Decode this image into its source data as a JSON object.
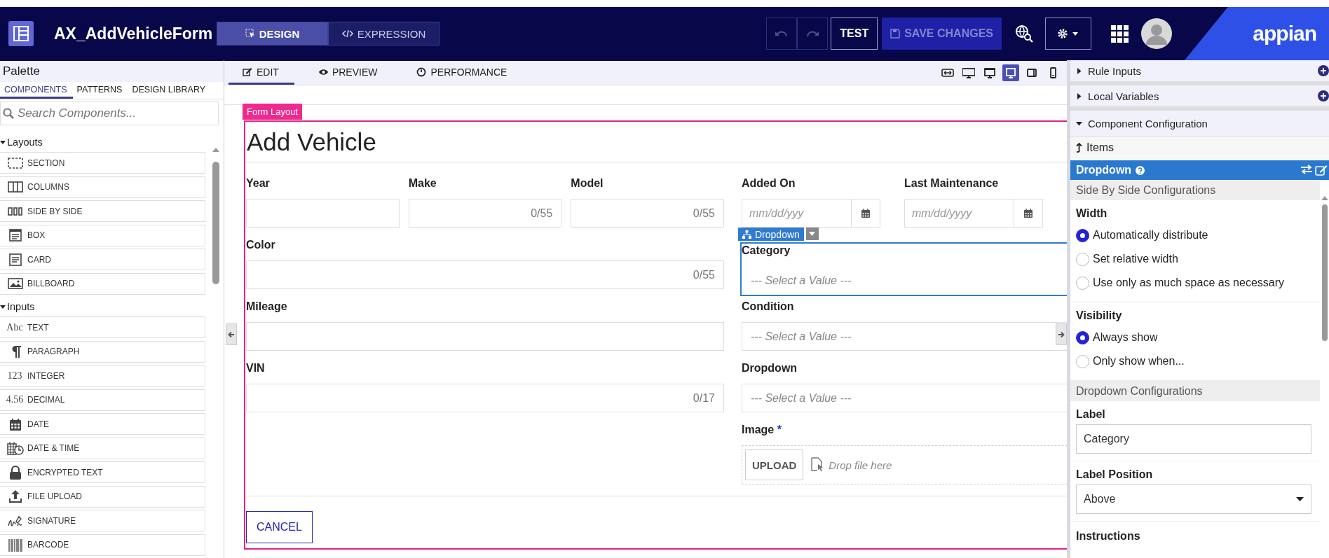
{
  "header": {
    "title": "AX_AddVehicleForm",
    "mode_tabs": [
      {
        "label": "DESIGN",
        "kind": "design",
        "selected": true
      },
      {
        "label": "EXPRESSION",
        "kind": "expression",
        "selected": false
      }
    ],
    "history_buttons": [
      {
        "kind": "undo",
        "disabled": true
      },
      {
        "kind": "redo",
        "disabled": true
      }
    ],
    "test_button": {
      "label": "TEST"
    },
    "save_button": {
      "label": "SAVE CHANGES",
      "disabled": true
    },
    "logo": "appian"
  },
  "palette": {
    "title": "Palette",
    "tabs": [
      {
        "label": "COMPONENTS",
        "selected": true
      },
      {
        "label": "PATTERNS",
        "selected": false
      },
      {
        "label": "DESIGN LIBRARY",
        "selected": false
      }
    ],
    "search": {
      "placeholder": "Search Components..."
    },
    "groups": [
      {
        "label": "Layouts",
        "expanded": true,
        "items": [
          {
            "label": "SECTION",
            "kind": "section"
          },
          {
            "label": "COLUMNS",
            "kind": "columns"
          },
          {
            "label": "SIDE BY SIDE",
            "kind": "sidebyside"
          },
          {
            "label": "BOX",
            "kind": "box"
          },
          {
            "label": "CARD",
            "kind": "card"
          },
          {
            "label": "BILLBOARD",
            "kind": "billboard"
          }
        ]
      },
      {
        "label": "Inputs",
        "expanded": true,
        "items": [
          {
            "label": "TEXT",
            "kind": "glyph",
            "glyph": "Abc"
          },
          {
            "label": "PARAGRAPH",
            "kind": "paragraph"
          },
          {
            "label": "INTEGER",
            "kind": "glyph",
            "glyph": "123"
          },
          {
            "label": "DECIMAL",
            "kind": "glyph",
            "glyph": "4.56"
          },
          {
            "label": "DATE",
            "kind": "date"
          },
          {
            "label": "DATE & TIME",
            "kind": "datetime"
          },
          {
            "label": "ENCRYPTED TEXT",
            "kind": "lock"
          },
          {
            "label": "FILE UPLOAD",
            "kind": "upload"
          },
          {
            "label": "SIGNATURE",
            "kind": "signature"
          },
          {
            "label": "BARCODE",
            "kind": "barcode"
          }
        ]
      }
    ]
  },
  "canvas": {
    "view_tabs": [
      {
        "label": "EDIT",
        "kind": "edit",
        "selected": true
      },
      {
        "label": "PREVIEW",
        "kind": "preview",
        "selected": false
      },
      {
        "label": "PERFORMANCE",
        "kind": "performance",
        "selected": false
      }
    ],
    "device_buttons": [
      {
        "kind": "fit",
        "selected": false
      },
      {
        "kind": "wide",
        "selected": false
      },
      {
        "kind": "desktop",
        "selected": false
      },
      {
        "kind": "monitor",
        "selected": true
      },
      {
        "kind": "tablet",
        "selected": false
      },
      {
        "kind": "phone",
        "selected": false
      }
    ],
    "form": {
      "tag": "Form Layout",
      "title": "Add Vehicle",
      "top_left": [
        {
          "kind": "text",
          "label": "Year",
          "selected": false
        },
        {
          "kind": "text",
          "label": "Make",
          "counter": "0/55",
          "selected": false
        },
        {
          "kind": "text",
          "label": "Model",
          "counter": "0/55",
          "selected": false
        }
      ],
      "top_right": [
        {
          "kind": "date",
          "label": "Added On",
          "placeholder": "mm/dd/yyy",
          "selected": false
        },
        {
          "kind": "date",
          "label": "Last Maintenance",
          "placeholder": "mm/dd/yyyy",
          "selected": false
        }
      ],
      "left_column": [
        {
          "kind": "text",
          "label": "Color",
          "counter": "0/55",
          "selected": false
        },
        {
          "kind": "text",
          "label": "Mileage",
          "selected": false
        },
        {
          "kind": "text",
          "label": "VIN",
          "counter": "0/17",
          "selected": false
        }
      ],
      "right_column": [
        {
          "kind": "dropdown",
          "label": "Category",
          "placeholder": "--- Select a Value ---",
          "selected": true,
          "tag": "Dropdown"
        },
        {
          "kind": "dropdown",
          "label": "Condition",
          "placeholder": "--- Select a Value ---",
          "selected": false
        },
        {
          "kind": "dropdown",
          "label": "Dropdown",
          "placeholder": "--- Select a Value ---",
          "selected": false
        },
        {
          "kind": "upload",
          "label": "Image",
          "required": true,
          "required_mark": "*",
          "button": "UPLOAD",
          "hint": "Drop file here",
          "selected": false
        }
      ],
      "buttons": [
        {
          "label": "CANCEL"
        }
      ]
    }
  },
  "config_panel": {
    "sections": [
      {
        "label": "Rule Inputs",
        "expanded": false,
        "addable": true
      },
      {
        "label": "Local Variables",
        "expanded": false,
        "addable": true
      },
      {
        "label": "Component Configuration",
        "expanded": true,
        "addable": false
      }
    ],
    "breadcrumb": "Items",
    "component_title": "Dropdown",
    "groups": [
      {
        "title": "Side By Side Configurations",
        "properties": [
          {
            "kind": "radio",
            "label": "Width",
            "options": [
              {
                "label": "Automatically distribute",
                "selected": true
              },
              {
                "label": "Set relative width",
                "selected": false
              },
              {
                "label": "Use only as much space as necessary",
                "selected": false
              }
            ]
          },
          {
            "kind": "radio",
            "label": "Visibility",
            "options": [
              {
                "label": "Always show",
                "selected": true
              },
              {
                "label": "Only show when...",
                "selected": false
              }
            ]
          }
        ]
      },
      {
        "title": "Dropdown Configurations",
        "properties": [
          {
            "kind": "text",
            "label": "Label",
            "value": "Category"
          },
          {
            "kind": "select",
            "label": "Label Position",
            "value": "Above"
          },
          {
            "kind": "heading",
            "label": "Instructions"
          }
        ]
      }
    ]
  }
}
